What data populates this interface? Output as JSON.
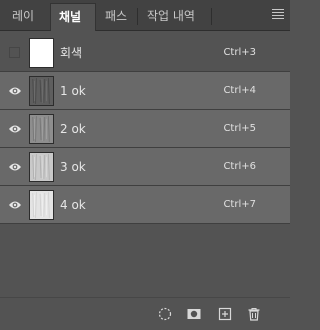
{
  "tabs": [
    {
      "label": "레이어",
      "active": false
    },
    {
      "label": "채널",
      "active": true
    },
    {
      "label": "패스",
      "active": false
    },
    {
      "label": "작업 내역",
      "active": false
    }
  ],
  "panel_menu_icon": "hamburger-icon",
  "channels": [
    {
      "name": "회색",
      "shortcut": "Ctrl+3",
      "visible": false,
      "selected": false,
      "thumb": "white"
    },
    {
      "name": "1 ok",
      "shortcut": "Ctrl+4",
      "visible": true,
      "selected": true,
      "thumb": "dark-texture"
    },
    {
      "name": "2 ok",
      "shortcut": "Ctrl+5",
      "visible": true,
      "selected": true,
      "thumb": "mid-texture"
    },
    {
      "name": "3 ok",
      "shortcut": "Ctrl+6",
      "visible": true,
      "selected": true,
      "thumb": "light-texture"
    },
    {
      "name": "4 ok",
      "shortcut": "Ctrl+7",
      "visible": true,
      "selected": true,
      "thumb": "lighter-texture"
    }
  ],
  "footer_icons": [
    "load-selection-icon",
    "save-selection-as-channel-icon",
    "new-channel-icon",
    "delete-channel-icon"
  ],
  "colors": {
    "panel_bg": "#535353",
    "tabbar_bg": "#424242",
    "selected_row": "#696969",
    "text": "#e6e6e6"
  }
}
